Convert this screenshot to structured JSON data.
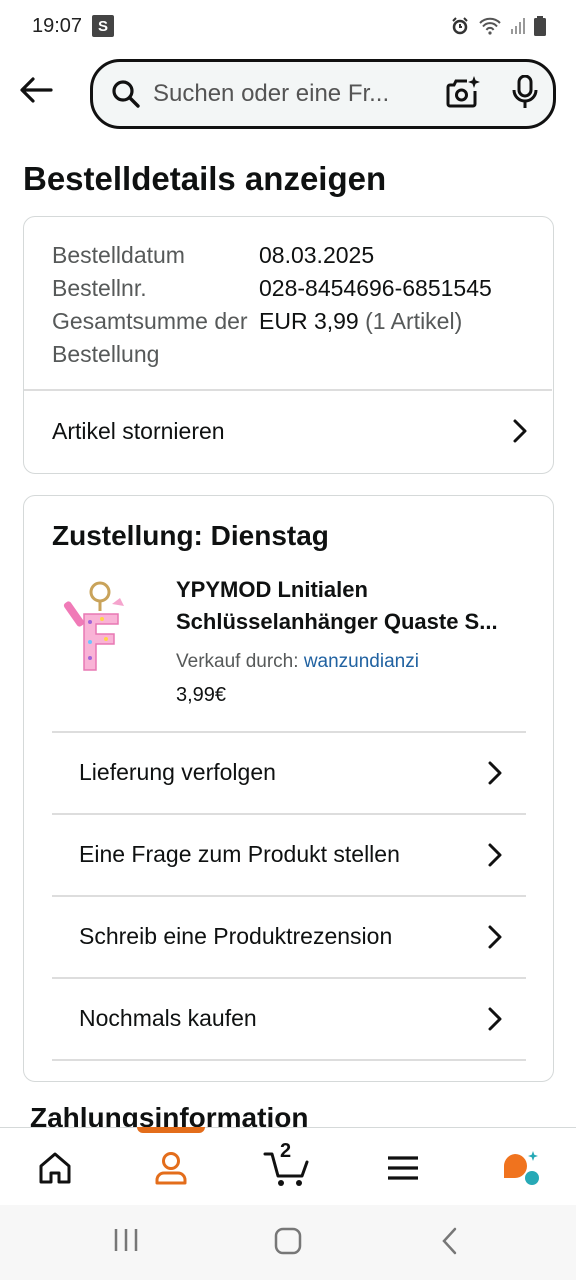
{
  "status_bar": {
    "time": "19:07",
    "s_badge": "S"
  },
  "search": {
    "placeholder": "Suchen oder eine Fr..."
  },
  "page": {
    "title": "Bestelldetails anzeigen"
  },
  "order": {
    "rows": [
      {
        "key": "Bestelldatum",
        "value": "08.03.2025"
      },
      {
        "key": "Bestellnr.",
        "value": "028-8454696-6851545"
      },
      {
        "key": "Gesamtsumme der Bestellung",
        "value": "EUR 3,99",
        "value_muted": "(1 Artikel)"
      }
    ],
    "cancel_label": "Artikel stornieren"
  },
  "delivery": {
    "title": "Zustellung: Dienstag",
    "product": {
      "title": "YPYMOD Lnitialen Schlüsselanhänger Quaste S...",
      "seller_prefix": "Verkauf durch:",
      "seller_name": "wanzundianzi",
      "price": "3,99€",
      "image_letter": "F"
    },
    "actions": [
      {
        "label": "Lieferung verfolgen"
      },
      {
        "label": "Eine Frage zum Produkt stellen"
      },
      {
        "label": "Schreib eine Produktrezension"
      },
      {
        "label": "Nochmals kaufen"
      }
    ]
  },
  "payment": {
    "title": "Zahlungsinformation"
  },
  "bottom_nav": {
    "cart_count": "2",
    "items": [
      "home-icon",
      "account-icon",
      "cart-icon",
      "menu-icon",
      "rufus-icon"
    ],
    "accent": "#e36d1b"
  }
}
